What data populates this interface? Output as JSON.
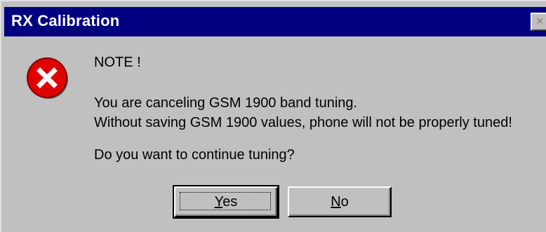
{
  "window": {
    "title": "RX Calibration",
    "close_glyph": "×"
  },
  "icon": {
    "name": "error-icon",
    "color": "#e00000"
  },
  "message": {
    "heading": "NOTE !",
    "line1": "You are canceling GSM 1900 band tuning.",
    "line2": "Without saving GSM 1900 values, phone will not be properly tuned!",
    "question": "Do you want to continue tuning?"
  },
  "buttons": {
    "yes": {
      "mnemonic": "Y",
      "rest": "es"
    },
    "no": {
      "mnemonic": "N",
      "rest": "o"
    }
  },
  "colors": {
    "titlebar": "#000080",
    "face": "#c0c0c0"
  }
}
